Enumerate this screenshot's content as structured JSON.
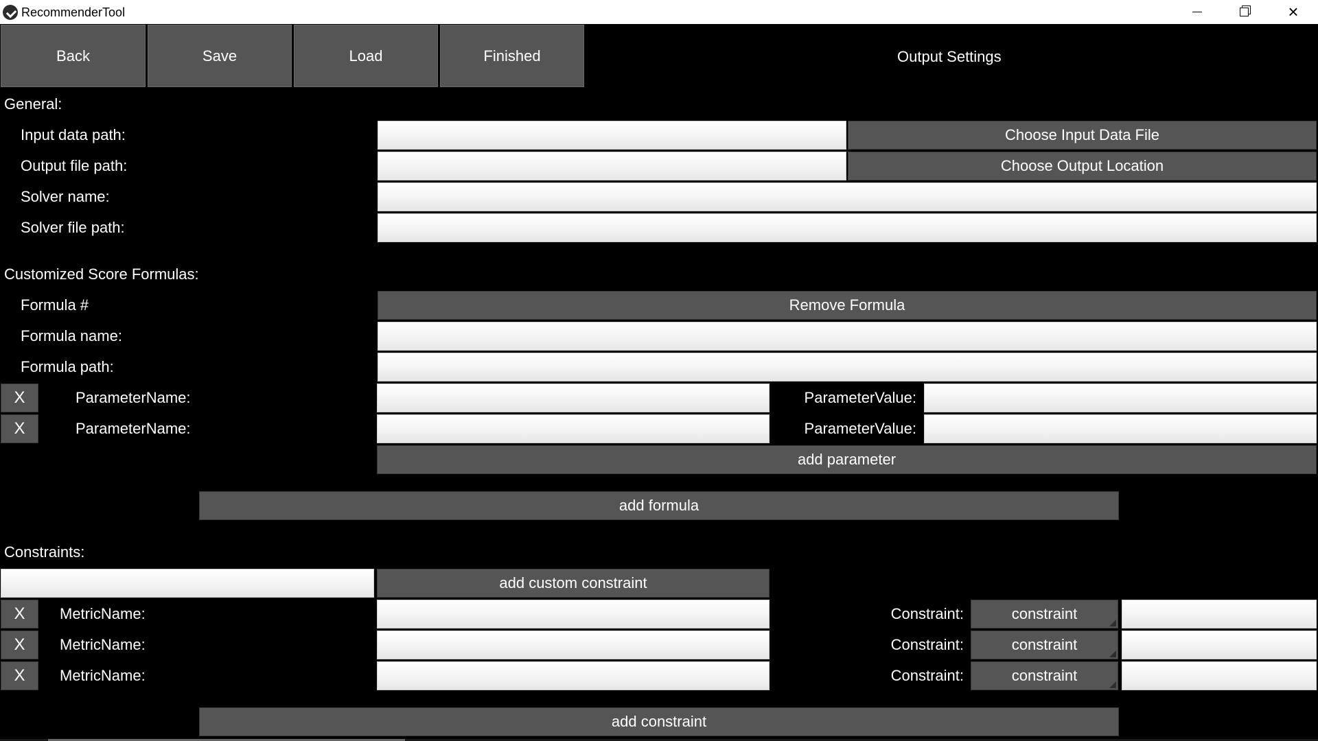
{
  "window": {
    "title": "RecommenderTool"
  },
  "toolbar": {
    "back": "Back",
    "save": "Save",
    "load": "Load",
    "finished": "Finished",
    "page_title": "Output Settings"
  },
  "general": {
    "heading": "General:",
    "input_data_path_label": "Input data path:",
    "input_data_path_value": "",
    "choose_input_button": "Choose Input Data File",
    "output_file_path_label": "Output file path:",
    "output_file_path_value": "",
    "choose_output_button": "Choose Output Location",
    "solver_name_label": "Solver name:",
    "solver_name_value": "",
    "solver_file_path_label": "Solver file path:",
    "solver_file_path_value": ""
  },
  "formulas": {
    "heading": "Customized Score Formulas:",
    "formula_number_label": "Formula #",
    "remove_formula_button": "Remove Formula",
    "formula_name_label": "Formula name:",
    "formula_name_value": "",
    "formula_path_label": "Formula path:",
    "formula_path_value": "",
    "parameters": [
      {
        "remove": "X",
        "name_label": "ParameterName:",
        "name_value": "",
        "value_label": "ParameterValue:",
        "value_value": ""
      },
      {
        "remove": "X",
        "name_label": "ParameterName:",
        "name_value": "",
        "value_label": "ParameterValue:",
        "value_value": ""
      }
    ],
    "add_parameter_button": "add parameter",
    "add_formula_button": "add formula"
  },
  "constraints": {
    "heading": "Constraints:",
    "custom_constraint_value": "",
    "add_custom_constraint_button": "add custom constraint",
    "rows": [
      {
        "remove": "X",
        "metric_label": "MetricName:",
        "metric_value": "",
        "constraint_label": "Constraint:",
        "constraint_select": "constraint",
        "constraint_value": ""
      },
      {
        "remove": "X",
        "metric_label": "MetricName:",
        "metric_value": "",
        "constraint_label": "Constraint:",
        "constraint_select": "constraint",
        "constraint_value": ""
      },
      {
        "remove": "X",
        "metric_label": "MetricName:",
        "metric_value": "",
        "constraint_label": "Constraint:",
        "constraint_select": "constraint",
        "constraint_value": ""
      }
    ],
    "add_constraint_button": "add constraint"
  },
  "icons": {
    "app": "app-logo-icon",
    "minimize": "minimize-icon",
    "maximize": "restore-icon",
    "close": "close-icon"
  }
}
